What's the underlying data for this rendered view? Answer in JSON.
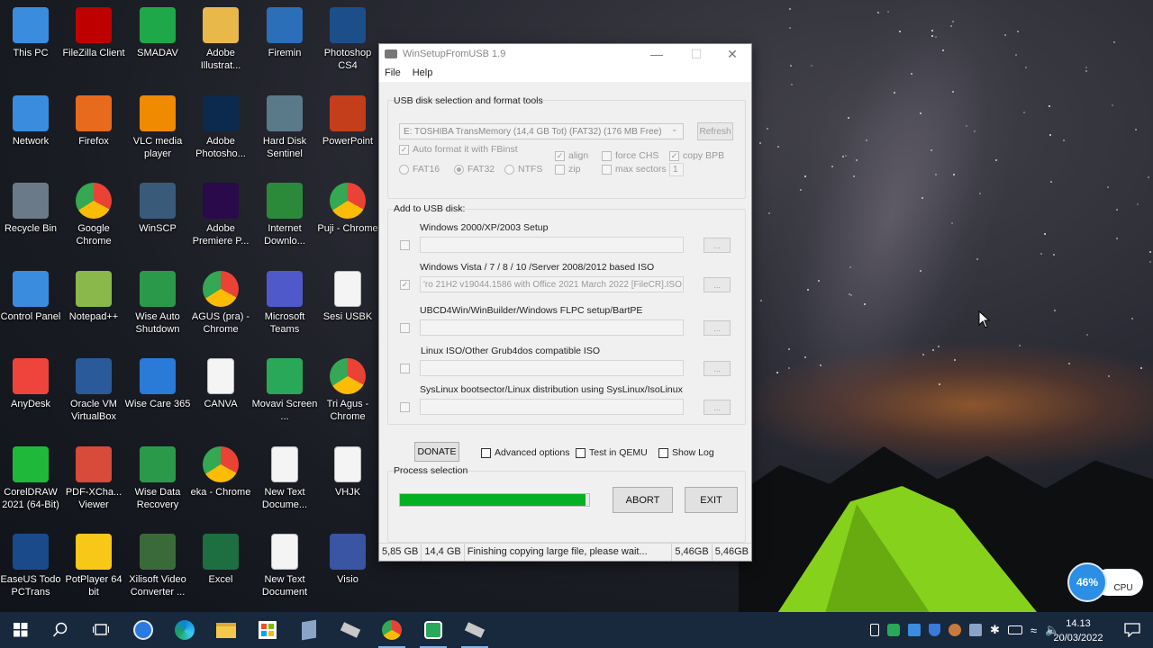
{
  "desktop": {
    "icons": [
      {
        "label": "This PC",
        "icon": "this-pc-icon",
        "color": "#3a8dde"
      },
      {
        "label": "FileZilla Client",
        "icon": "filezilla-icon",
        "color": "#bf0000"
      },
      {
        "label": "SMADAV",
        "icon": "smadav-icon",
        "color": "#1ea84a"
      },
      {
        "label": "Adobe Illustrat...",
        "icon": "folder-icon",
        "color": "#e8b84a"
      },
      {
        "label": "Firemin",
        "icon": "firemin-icon",
        "color": "#2a6fb8"
      },
      {
        "label": "Photoshop CS4",
        "icon": "photoshop-icon",
        "color": "#1c4f8a"
      },
      {
        "label": "Network",
        "icon": "network-icon",
        "color": "#3a8dde"
      },
      {
        "label": "Firefox",
        "icon": "firefox-icon",
        "color": "#e86a1c"
      },
      {
        "label": "VLC media player",
        "icon": "vlc-icon",
        "color": "#f08a00"
      },
      {
        "label": "Adobe Photosho...",
        "icon": "photoshop-icon",
        "color": "#0c2a4e"
      },
      {
        "label": "Hard Disk Sentinel",
        "icon": "hard-disk-sentinel-icon",
        "color": "#5a7a8a"
      },
      {
        "label": "PowerPoint",
        "icon": "powerpoint-icon",
        "color": "#c43e1c"
      },
      {
        "label": "Recycle Bin",
        "icon": "recycle-bin-icon",
        "color": "#6a7a88"
      },
      {
        "label": "Google Chrome",
        "icon": "chrome-icon",
        "color": "#34a853"
      },
      {
        "label": "WinSCP",
        "icon": "winscp-icon",
        "color": "#3a5a7a"
      },
      {
        "label": "Adobe Premiere P...",
        "icon": "premiere-icon",
        "color": "#2a0a4a"
      },
      {
        "label": "Internet Downlo...",
        "icon": "idm-icon",
        "color": "#2a8a3a"
      },
      {
        "label": "Puji - Chrome",
        "icon": "chrome-icon",
        "color": "#34a853"
      },
      {
        "label": "Control Panel",
        "icon": "control-panel-icon",
        "color": "#3a8dde"
      },
      {
        "label": "Notepad++",
        "icon": "notepad-plus-plus-icon",
        "color": "#8ab84a"
      },
      {
        "label": "Wise Auto Shutdown",
        "icon": "wise-auto-shutdown-icon",
        "color": "#2a9a4a"
      },
      {
        "label": "AGUS (pra) - Chrome",
        "icon": "chrome-icon",
        "color": "#34a853"
      },
      {
        "label": "Microsoft Teams",
        "icon": "teams-icon",
        "color": "#5059c9"
      },
      {
        "label": "Sesi USBK",
        "icon": "document-icon",
        "color": "#f4f4f4"
      },
      {
        "label": "AnyDesk",
        "icon": "anydesk-icon",
        "color": "#ef443b"
      },
      {
        "label": "Oracle VM VirtualBox",
        "icon": "virtualbox-icon",
        "color": "#2a5a9a"
      },
      {
        "label": "Wise Care 365",
        "icon": "wise-care-icon",
        "color": "#2a7ad8"
      },
      {
        "label": "CANVA",
        "icon": "document-icon",
        "color": "#f4f4f4"
      },
      {
        "label": "Movavi Screen ...",
        "icon": "movavi-icon",
        "color": "#2aa85a"
      },
      {
        "label": "Tri Agus - Chrome",
        "icon": "chrome-icon",
        "color": "#34a853"
      },
      {
        "label": "CorelDRAW 2021 (64-Bit)",
        "icon": "coreldraw-icon",
        "color": "#20b83a"
      },
      {
        "label": "PDF-XCha... Viewer",
        "icon": "pdf-xchange-icon",
        "color": "#d84a3a"
      },
      {
        "label": "Wise Data Recovery",
        "icon": "wise-data-recovery-icon",
        "color": "#2a9a4a"
      },
      {
        "label": "eka - Chrome",
        "icon": "chrome-icon",
        "color": "#34a853"
      },
      {
        "label": "New Text Docume...",
        "icon": "document-icon",
        "color": "#f4f4f4"
      },
      {
        "label": "VHJK",
        "icon": "document-icon",
        "color": "#f4f4f4"
      },
      {
        "label": "EaseUS Todo PCTrans",
        "icon": "easeus-icon",
        "color": "#1a4a8a"
      },
      {
        "label": "PotPlayer 64 bit",
        "icon": "potplayer-icon",
        "color": "#f8c818"
      },
      {
        "label": "Xilisoft Video Converter ...",
        "icon": "xilisoft-icon",
        "color": "#3a6a3a"
      },
      {
        "label": "Excel",
        "icon": "excel-icon",
        "color": "#1d6f42"
      },
      {
        "label": "New Text Document",
        "icon": "document-icon",
        "color": "#f4f4f4"
      },
      {
        "label": "Visio",
        "icon": "visio-icon",
        "color": "#3955a3"
      }
    ]
  },
  "window": {
    "title": "WinSetupFromUSB 1.9",
    "menu": [
      "File",
      "Help"
    ],
    "usb_group_title": "USB disk selection and format tools",
    "usb_disk": "E: TOSHIBA TransMemory (14,4 GB Tot) (FAT32) (176 MB Free)",
    "refresh": "Refresh",
    "auto_format": "Auto format it with FBinst",
    "fat16": "FAT16",
    "fat32": "FAT32",
    "ntfs": "NTFS",
    "align": "align",
    "zip": "zip",
    "force_chs": "force CHS",
    "max_sectors": "max sectors",
    "copy_bpb": "copy BPB",
    "max_sectors_value": "1",
    "add_group_title": "Add to USB disk:",
    "sources": [
      {
        "label": "Windows 2000/XP/2003 Setup",
        "path": "",
        "checked": ""
      },
      {
        "label": "Windows Vista / 7 / 8 / 10 /Server 2008/2012 based ISO",
        "path": "'ro 21H2 v19044.1586 with Office 2021 March 2022 [FileCR].ISO",
        "checked": "✓"
      },
      {
        "label": "UBCD4Win/WinBuilder/Windows FLPC setup/BartPE",
        "path": "",
        "checked": ""
      },
      {
        "label": "Linux ISO/Other Grub4dos compatible ISO",
        "path": "",
        "checked": ""
      },
      {
        "label": "SysLinux bootsector/Linux distribution using SysLinux/IsoLinux",
        "path": "",
        "checked": ""
      }
    ],
    "browse": "...",
    "donate": "DONATE",
    "advanced_options": "Advanced options",
    "test_qemu": "Test in QEMU",
    "show_log": "Show Log",
    "process_title": "Process selection",
    "progress": 0.98,
    "abort": "ABORT",
    "exit": "EXIT",
    "status": [
      "5,85 GB",
      "14,4 GB",
      "Finishing copying large file, please wait...",
      "5,46GB",
      "5,46GB"
    ]
  },
  "cpu_widget": {
    "percent": "46%",
    "label": "CPU"
  },
  "taskbar": {
    "time": "14.13",
    "date": "20/03/2022"
  },
  "colors": {
    "progress": "#06b025",
    "taskbar": "#18283d",
    "tent": "#86d11b"
  }
}
